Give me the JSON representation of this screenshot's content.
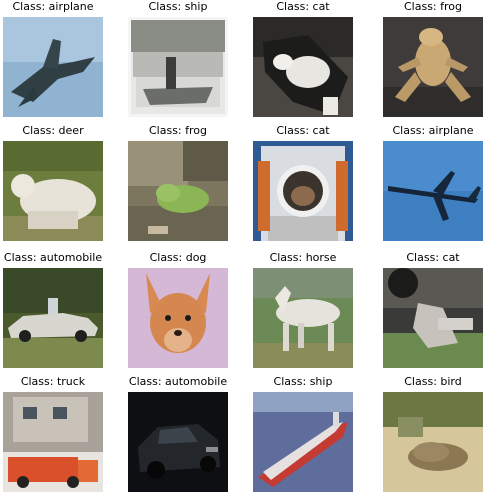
{
  "grid": [
    {
      "label": "Class: airplane"
    },
    {
      "label": "Class: ship"
    },
    {
      "label": "Class: cat"
    },
    {
      "label": "Class: frog"
    },
    {
      "label": "Class: deer"
    },
    {
      "label": "Class: frog"
    },
    {
      "label": "Class: cat"
    },
    {
      "label": "Class: airplane"
    },
    {
      "label": "Class: automobile"
    },
    {
      "label": "Class: dog"
    },
    {
      "label": "Class: horse"
    },
    {
      "label": "Class: cat"
    },
    {
      "label": "Class: truck"
    },
    {
      "label": "Class: automobile"
    },
    {
      "label": "Class: ship"
    },
    {
      "label": "Class: bird"
    }
  ]
}
